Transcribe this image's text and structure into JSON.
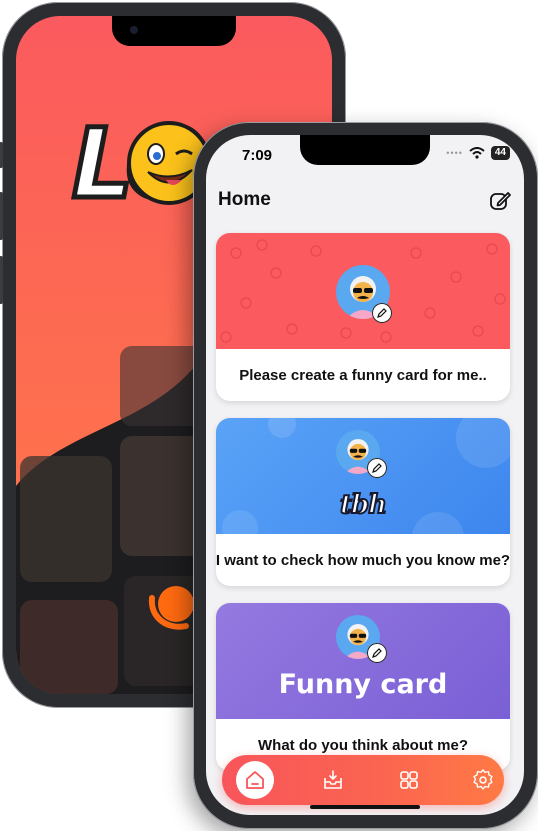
{
  "back_phone": {
    "logo_text": "LO",
    "colors": {
      "screen_top": "#fb5a5e",
      "screen_bottom": "#ff7a47",
      "logo_accent": "#ff6a10"
    }
  },
  "front_phone": {
    "status_bar": {
      "time": "7:09",
      "battery": "44"
    },
    "header": {
      "title": "Home",
      "edit_icon": "edit-icon"
    },
    "cards": [
      {
        "banner_style": "emoji-pattern",
        "banner_color": "#fb5a5e",
        "banner_text": "",
        "label": "Please create a funny card for me.."
      },
      {
        "banner_style": "bubbles",
        "banner_color": "#4b95f5",
        "banner_text": "tbh",
        "label": "I want to check how much you know me?"
      },
      {
        "banner_style": "plain",
        "banner_color": "#8a6fdc",
        "banner_text": "Funny card",
        "label": "What do you think about me?"
      }
    ],
    "tab_bar": {
      "tabs": [
        {
          "icon": "home-icon",
          "active": true
        },
        {
          "icon": "inbox-icon",
          "active": false
        },
        {
          "icon": "grid-icon",
          "active": false
        },
        {
          "icon": "settings-icon",
          "active": false
        }
      ],
      "colors": {
        "left": "#f8555a",
        "right": "#ff7a45"
      }
    }
  }
}
